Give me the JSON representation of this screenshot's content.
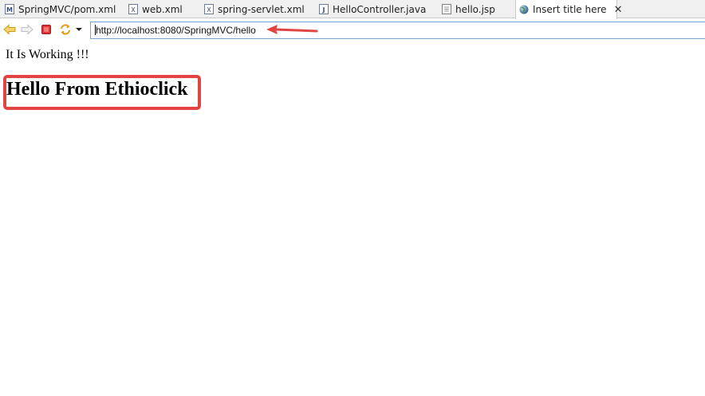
{
  "tabs": [
    {
      "label": "SpringMVC/pom.xml",
      "icon": "maven-file-icon"
    },
    {
      "label": "web.xml",
      "icon": "xml-file-icon"
    },
    {
      "label": "spring-servlet.xml",
      "icon": "xml-file-icon"
    },
    {
      "label": "HelloController.java",
      "icon": "java-file-icon"
    },
    {
      "label": "hello.jsp",
      "icon": "jsp-file-icon"
    },
    {
      "label": "Insert title here",
      "icon": "globe-icon",
      "active": true
    }
  ],
  "toolbar": {
    "url": "http://localhost:8080/SpringMVC/hello",
    "buttons": [
      "back-icon",
      "forward-icon",
      "stop-icon",
      "refresh-icon",
      "dropdown-icon"
    ]
  },
  "page": {
    "message": "It Is Working !!!",
    "heading": "Hello From Ethioclick"
  },
  "colors": {
    "annotation": "#e24444",
    "url_border": "#7aa7d6",
    "tabbar_bg": "#f0f0f0"
  }
}
